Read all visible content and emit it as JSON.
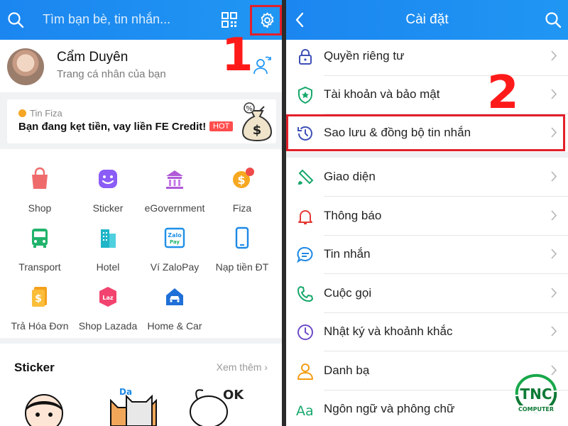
{
  "left": {
    "search_placeholder": "Tìm bạn bè, tin nhắn...",
    "profile": {
      "name": "Cẩm Duyên",
      "subtitle": "Trang cá nhân của bạn"
    },
    "promo": {
      "tag": "Tin Fiza",
      "text": "Bạn đang kẹt tiền, vay liền FE Credit!",
      "badge": "HOT"
    },
    "grid": [
      {
        "label": "Shop",
        "icon": "shop-bag-icon"
      },
      {
        "label": "Sticker",
        "icon": "sticker-smile-icon"
      },
      {
        "label": "eGovernment",
        "icon": "government-building-icon"
      },
      {
        "label": "Fiza",
        "icon": "fiza-coin-icon"
      },
      {
        "label": "Transport",
        "icon": "bus-icon"
      },
      {
        "label": "Hotel",
        "icon": "hotel-icon"
      },
      {
        "label": "Ví ZaloPay",
        "icon": "zalopay-icon"
      },
      {
        "label": "Nạp tiền ĐT",
        "icon": "phone-topup-icon"
      },
      {
        "label": "Trả Hóa Đơn",
        "icon": "bill-icon"
      },
      {
        "label": "Shop Lazada",
        "icon": "lazada-icon"
      },
      {
        "label": "Home & Car",
        "icon": "home-car-icon"
      }
    ],
    "sticker_section": {
      "title": "Sticker",
      "more": "Xem thêm"
    },
    "step_label": "1"
  },
  "right": {
    "title": "Cài đặt",
    "menu": [
      {
        "label": "Quyền riêng tư",
        "icon": "lock-icon"
      },
      {
        "label": "Tài khoản và bảo mật",
        "icon": "shield-icon"
      },
      {
        "label": "Sao lưu & đồng bộ tin nhắn",
        "icon": "backup-clock-icon"
      },
      {
        "label": "Giao diện",
        "icon": "paint-brush-icon"
      },
      {
        "label": "Thông báo",
        "icon": "bell-icon"
      },
      {
        "label": "Tin nhắn",
        "icon": "chat-bubble-icon"
      },
      {
        "label": "Cuộc gọi",
        "icon": "phone-icon"
      },
      {
        "label": "Nhật ký và khoảnh khắc",
        "icon": "clock-icon"
      },
      {
        "label": "Danh bạ",
        "icon": "contact-person-icon"
      },
      {
        "label": "Ngôn ngữ và phông chữ",
        "icon": "language-aa-icon"
      }
    ],
    "step_label": "2"
  },
  "watermark": {
    "logo": "TNC",
    "sub": "COMPUTER"
  },
  "colors": {
    "header": "#1b86f0",
    "highlight": "#e3202a",
    "step": "#ff1a1a",
    "accent": "#2096f3"
  }
}
